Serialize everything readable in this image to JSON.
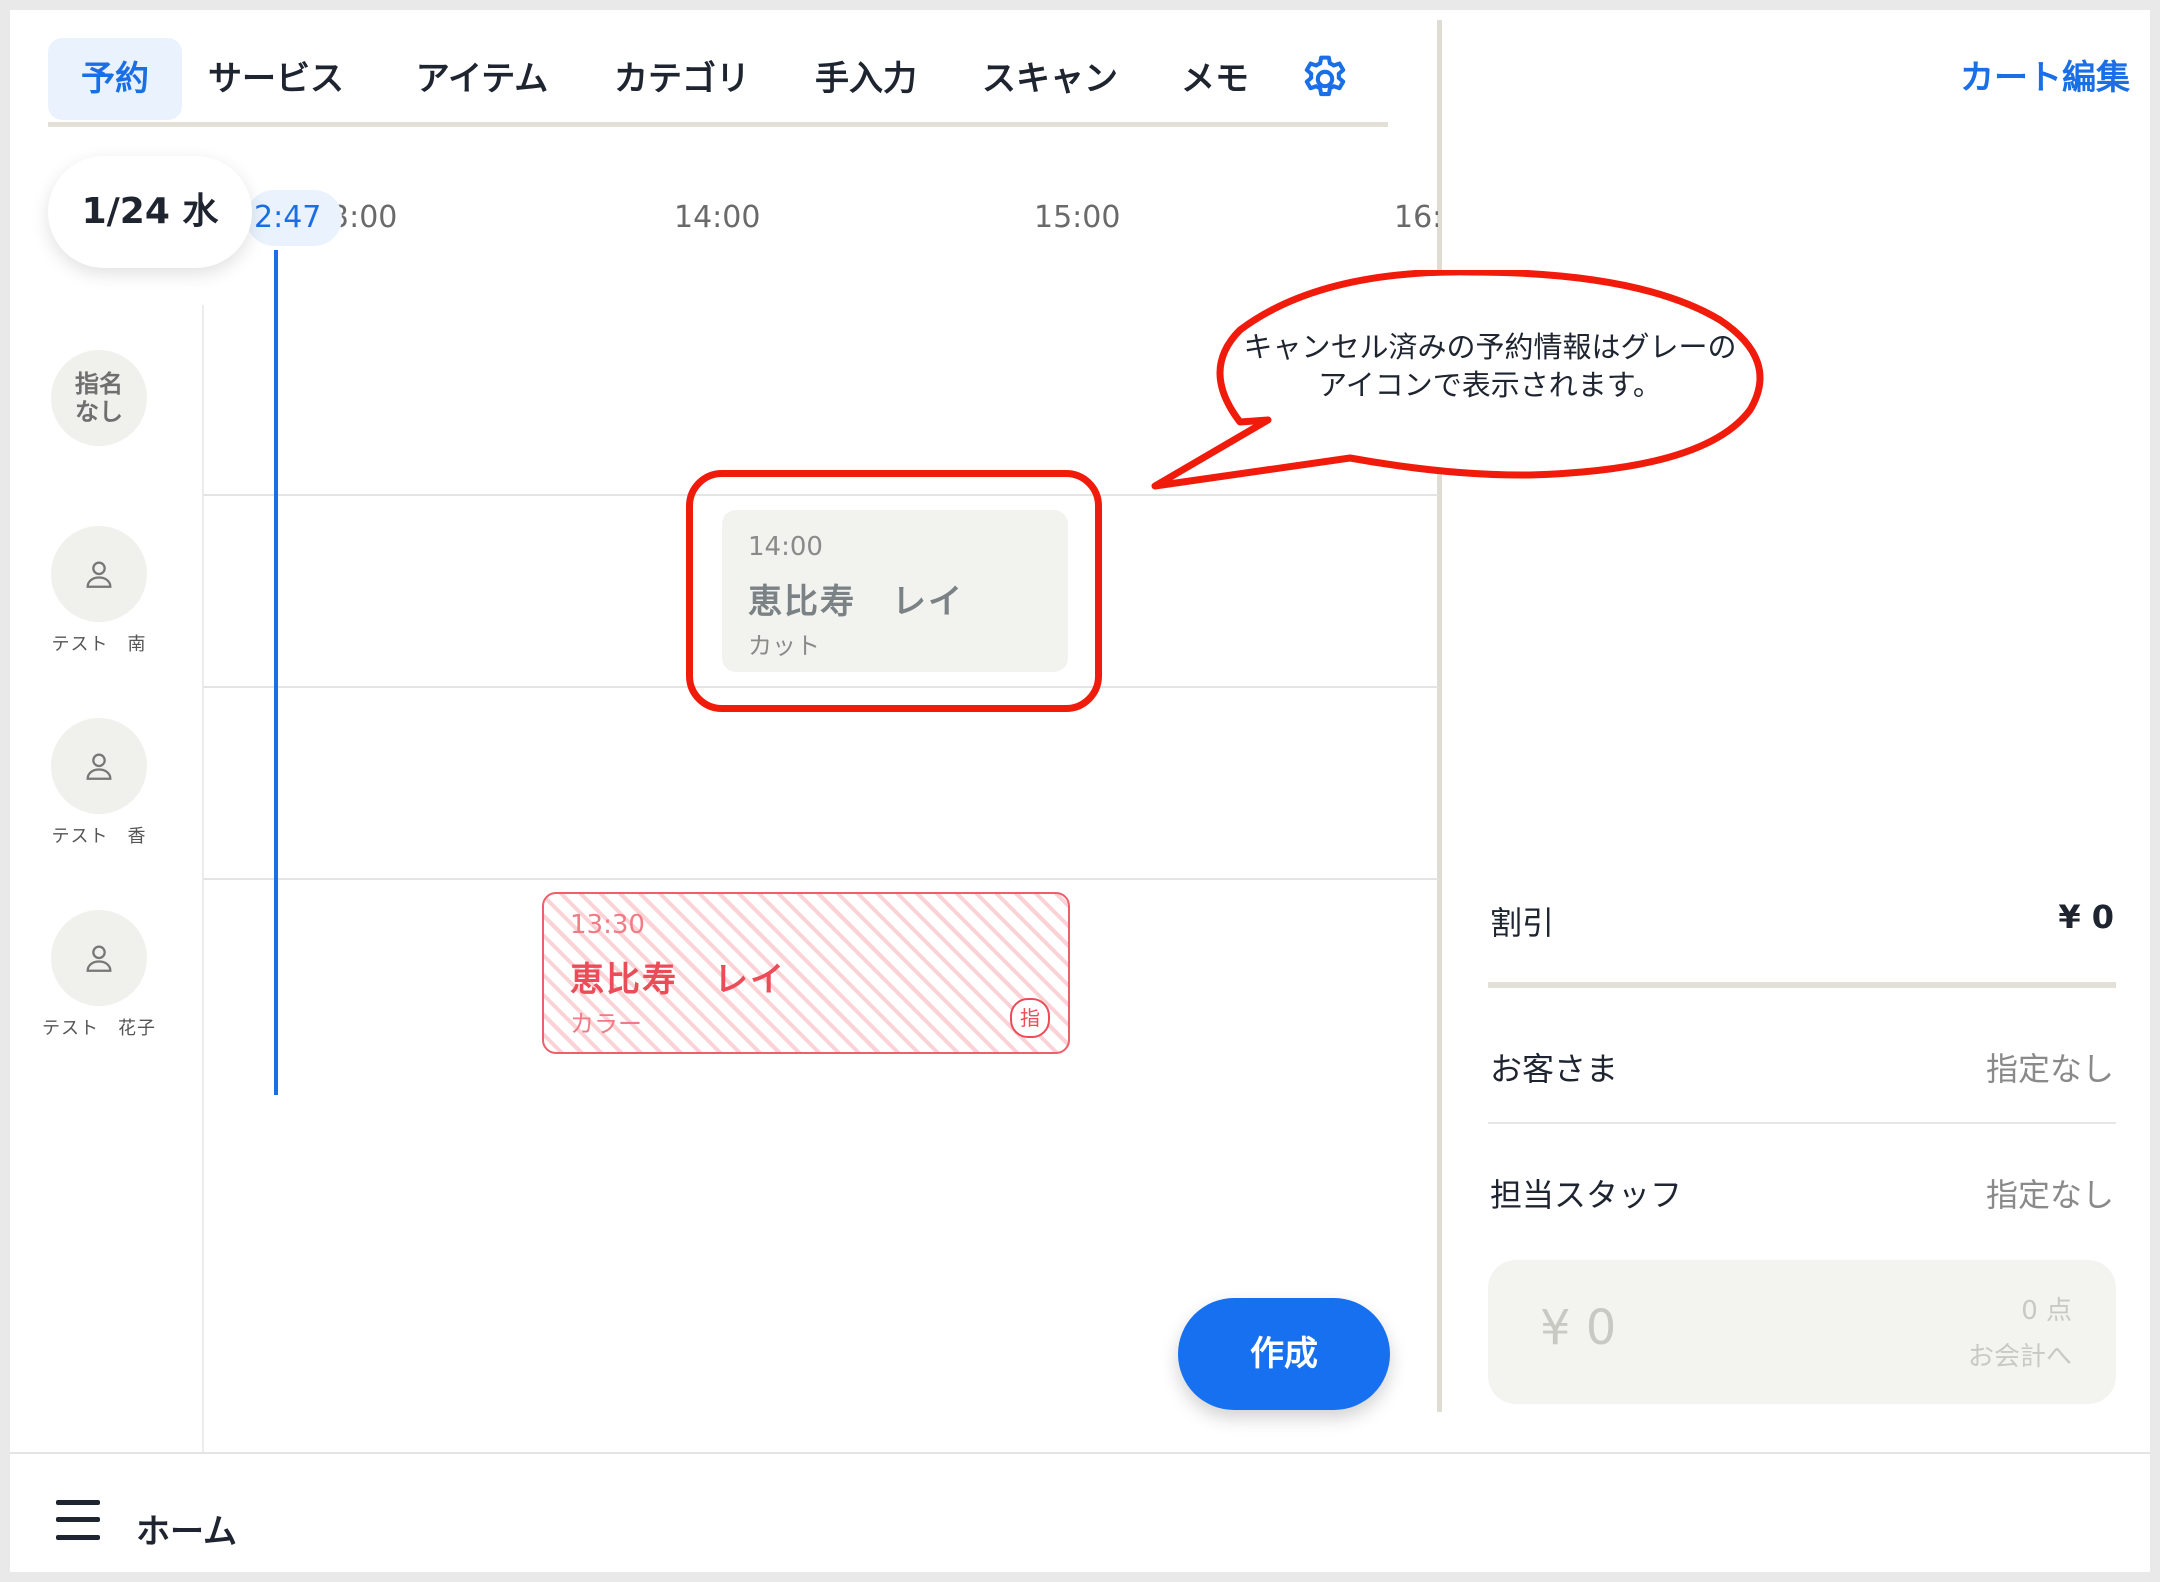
{
  "tabs": [
    {
      "label": "予約",
      "active": true
    },
    {
      "label": "サービス"
    },
    {
      "label": "アイテム"
    },
    {
      "label": "カテゴリ"
    },
    {
      "label": "手入力"
    },
    {
      "label": "スキャン"
    },
    {
      "label": "メモ"
    }
  ],
  "settings_icon": "gear-icon",
  "cart": {
    "edit_label": "カート編集"
  },
  "timeline": {
    "date": "1/24 水",
    "now": "12:47",
    "now_visible": "2:47",
    "hours": [
      "3:00",
      "14:00",
      "15:00",
      "16:"
    ]
  },
  "staff": [
    {
      "name": "指名\nなし",
      "icon": "none"
    },
    {
      "name": "テスト　南",
      "icon": "person-icon"
    },
    {
      "name": "テスト　香",
      "icon": "person-icon"
    },
    {
      "name": "テスト　花子",
      "icon": "person-icon"
    }
  ],
  "appointments": {
    "cancelled": {
      "time": "14:00",
      "customer": "恵比寿　レイ",
      "service": "カット",
      "status_color": "#7a8285"
    },
    "active": {
      "time": "13:30",
      "customer": "恵比寿　レイ",
      "service": "カラー",
      "badge": "指",
      "status_color": "#ec4b58"
    }
  },
  "callout": {
    "text": "キャンセル済みの予約情報はグレーのアイコンで表示されます。",
    "color": "#f11b0c"
  },
  "create_button": {
    "label": "作成"
  },
  "summary": {
    "discount_label": "割引",
    "discount_value": "¥ 0",
    "customer_label": "お客さま",
    "customer_value": "指定なし",
    "staff_label": "担当スタッフ",
    "staff_value": "指定なし"
  },
  "checkout": {
    "amount": "¥ 0",
    "count": "0 点",
    "label": "お会計へ"
  },
  "bottom": {
    "home_label": "ホーム",
    "menu_icon": "hamburger-icon"
  },
  "colors": {
    "accent": "#1a6fe6",
    "button": "#1670f0",
    "background": "#ffffff"
  }
}
